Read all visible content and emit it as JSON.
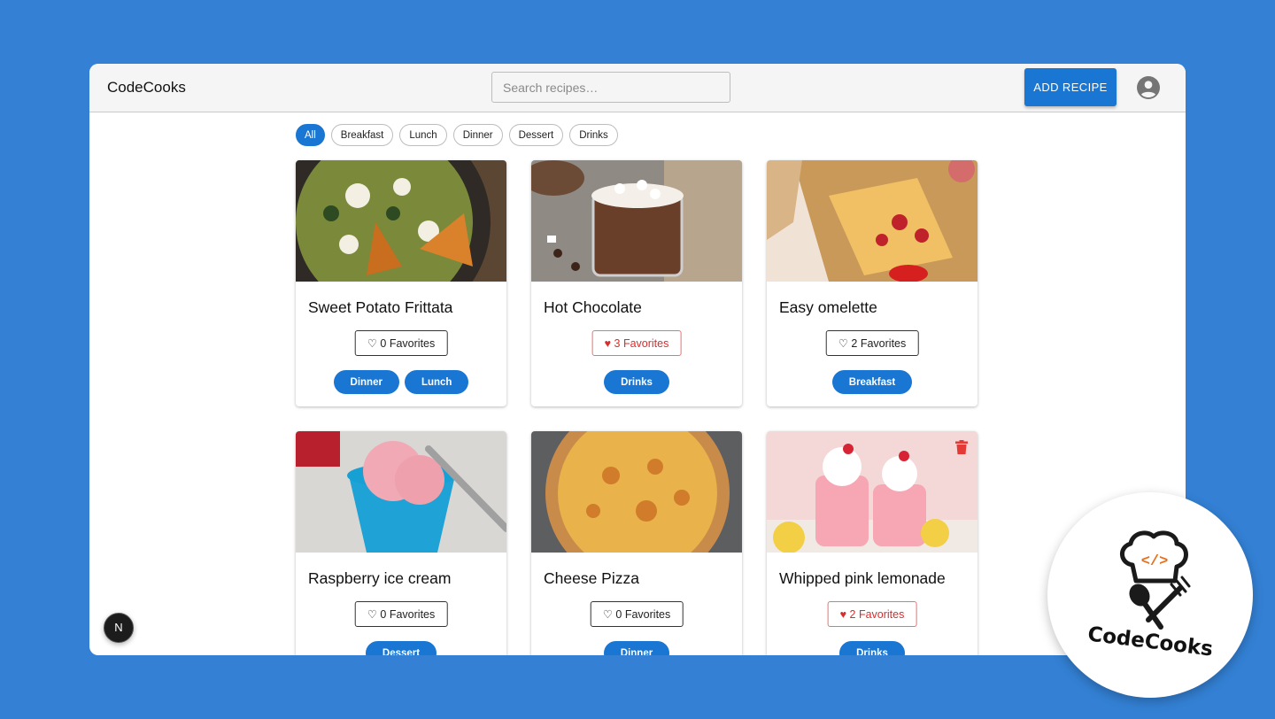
{
  "app": {
    "brand": "CodeCooks"
  },
  "header": {
    "search_placeholder": "Search recipes…",
    "add_recipe_label": "ADD RECIPE",
    "avatar_icon": "account-circle-icon"
  },
  "filters": [
    "All",
    "Breakfast",
    "Lunch",
    "Dinner",
    "Dessert",
    "Drinks"
  ],
  "active_filter": "All",
  "recipes": [
    {
      "title": "Sweet Potato Frittata",
      "favorites": "0 Favorites",
      "liked": false,
      "tags": [
        "Dinner",
        "Lunch"
      ]
    },
    {
      "title": "Hot Chocolate",
      "favorites": "3 Favorites",
      "liked": true,
      "tags": [
        "Drinks"
      ]
    },
    {
      "title": "Easy omelette",
      "favorites": "2 Favorites",
      "liked": false,
      "tags": [
        "Breakfast"
      ]
    },
    {
      "title": "Raspberry ice cream",
      "favorites": "0 Favorites",
      "liked": false,
      "tags": [
        "Dessert"
      ]
    },
    {
      "title": "Cheese Pizza",
      "favorites": "0 Favorites",
      "liked": false,
      "tags": [
        "Dinner"
      ]
    },
    {
      "title": "Whipped pink lemonade",
      "favorites": "2 Favorites",
      "liked": true,
      "tags": [
        "Drinks"
      ],
      "deletable": true
    }
  ],
  "icons": {
    "heart_outline": "♡",
    "heart_filled": "♥"
  },
  "dev_badge": "N",
  "logo": {
    "text": "CodeCooks",
    "code_symbol": "</>"
  },
  "colors": {
    "primary": "#1976d2",
    "background": "#3380d4",
    "liked": "#d32f2f",
    "delete": "#e53935"
  }
}
